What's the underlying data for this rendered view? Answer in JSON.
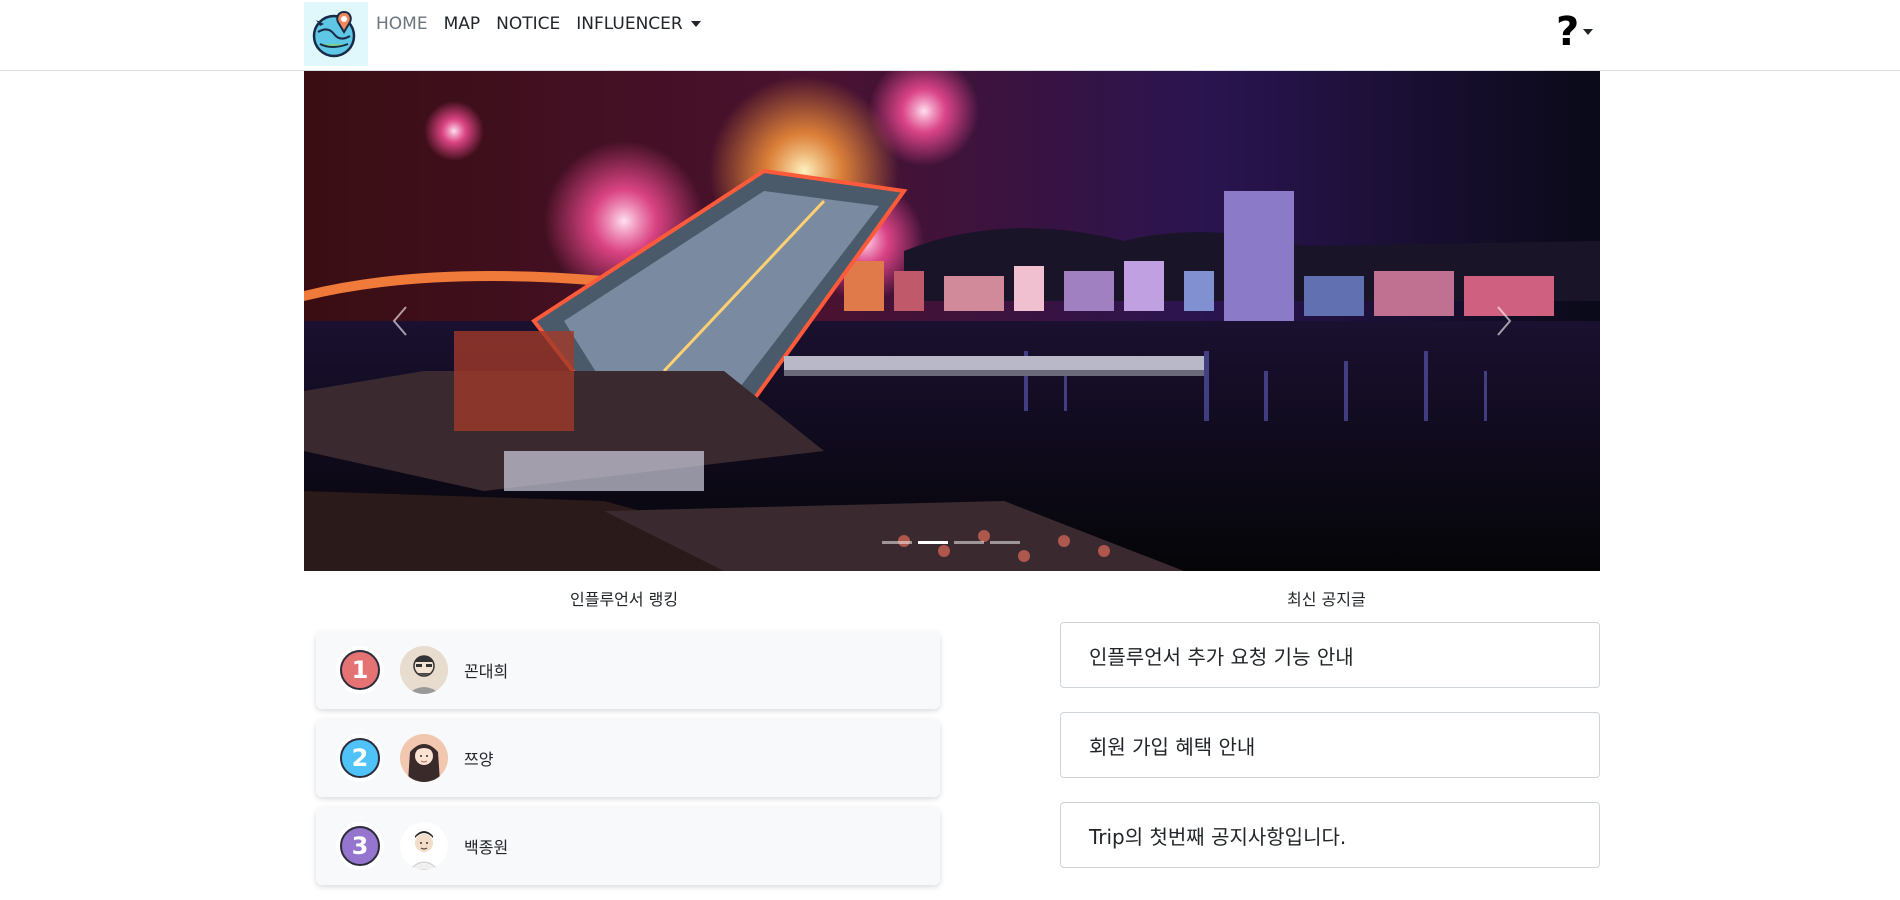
{
  "nav": {
    "brand_icon": "globe-travel-logo-icon",
    "links": [
      {
        "label": "HOME",
        "active": true
      },
      {
        "label": "MAP"
      },
      {
        "label": "NOTICE"
      },
      {
        "label": "INFLUENCER",
        "dropdown": true
      }
    ],
    "help_label": "?"
  },
  "carousel": {
    "prev_icon": "chevron-left-icon",
    "next_icon": "chevron-right-icon",
    "slide_count": 4,
    "active_index": 1
  },
  "ranking": {
    "title": "인플루언서 랭킹",
    "items": [
      {
        "rank": "1",
        "name": "꼰대희",
        "badge_color": "#e57373"
      },
      {
        "rank": "2",
        "name": "쯔양",
        "badge_color": "#4fc3f7"
      },
      {
        "rank": "3",
        "name": "백종원",
        "badge_color": "#9575cd"
      }
    ]
  },
  "notices": {
    "title": "최신 공지글",
    "items": [
      {
        "title": "인플루언서 추가 요청 기능 안내"
      },
      {
        "title": "회원 가입 혜택 안내"
      },
      {
        "title": "Trip의 첫번째 공지사항입니다."
      }
    ]
  }
}
